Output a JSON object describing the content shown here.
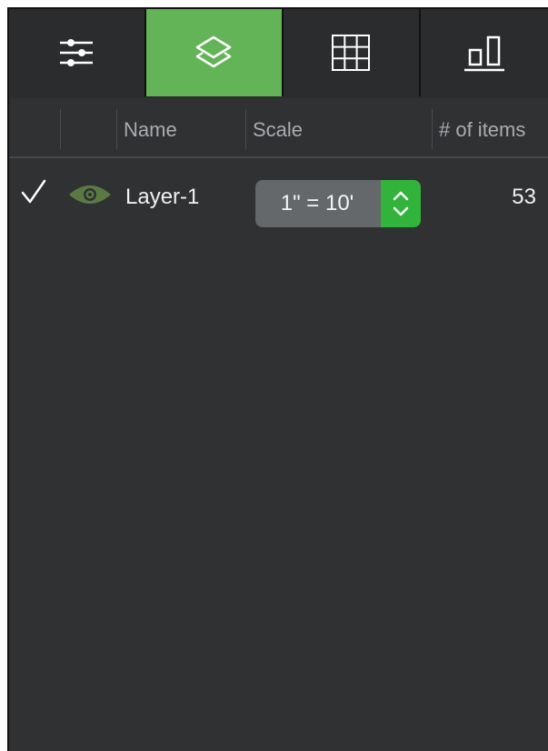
{
  "toolbar": {
    "tabs": [
      {
        "icon": "sliders-icon",
        "active": false
      },
      {
        "icon": "layers-icon",
        "active": true
      },
      {
        "icon": "grid-icon",
        "active": false
      },
      {
        "icon": "bar-chart-icon",
        "active": false
      }
    ],
    "accent_color": "#63b457"
  },
  "table": {
    "headers": {
      "name": "Name",
      "scale": "Scale",
      "items": "# of items"
    },
    "rows": [
      {
        "checked": true,
        "visible": true,
        "name": "Layer-1",
        "scale": "1\" = 10'",
        "items": "53"
      }
    ]
  },
  "colors": {
    "stepper": "#32b33b",
    "eye": "#5a7a44"
  }
}
